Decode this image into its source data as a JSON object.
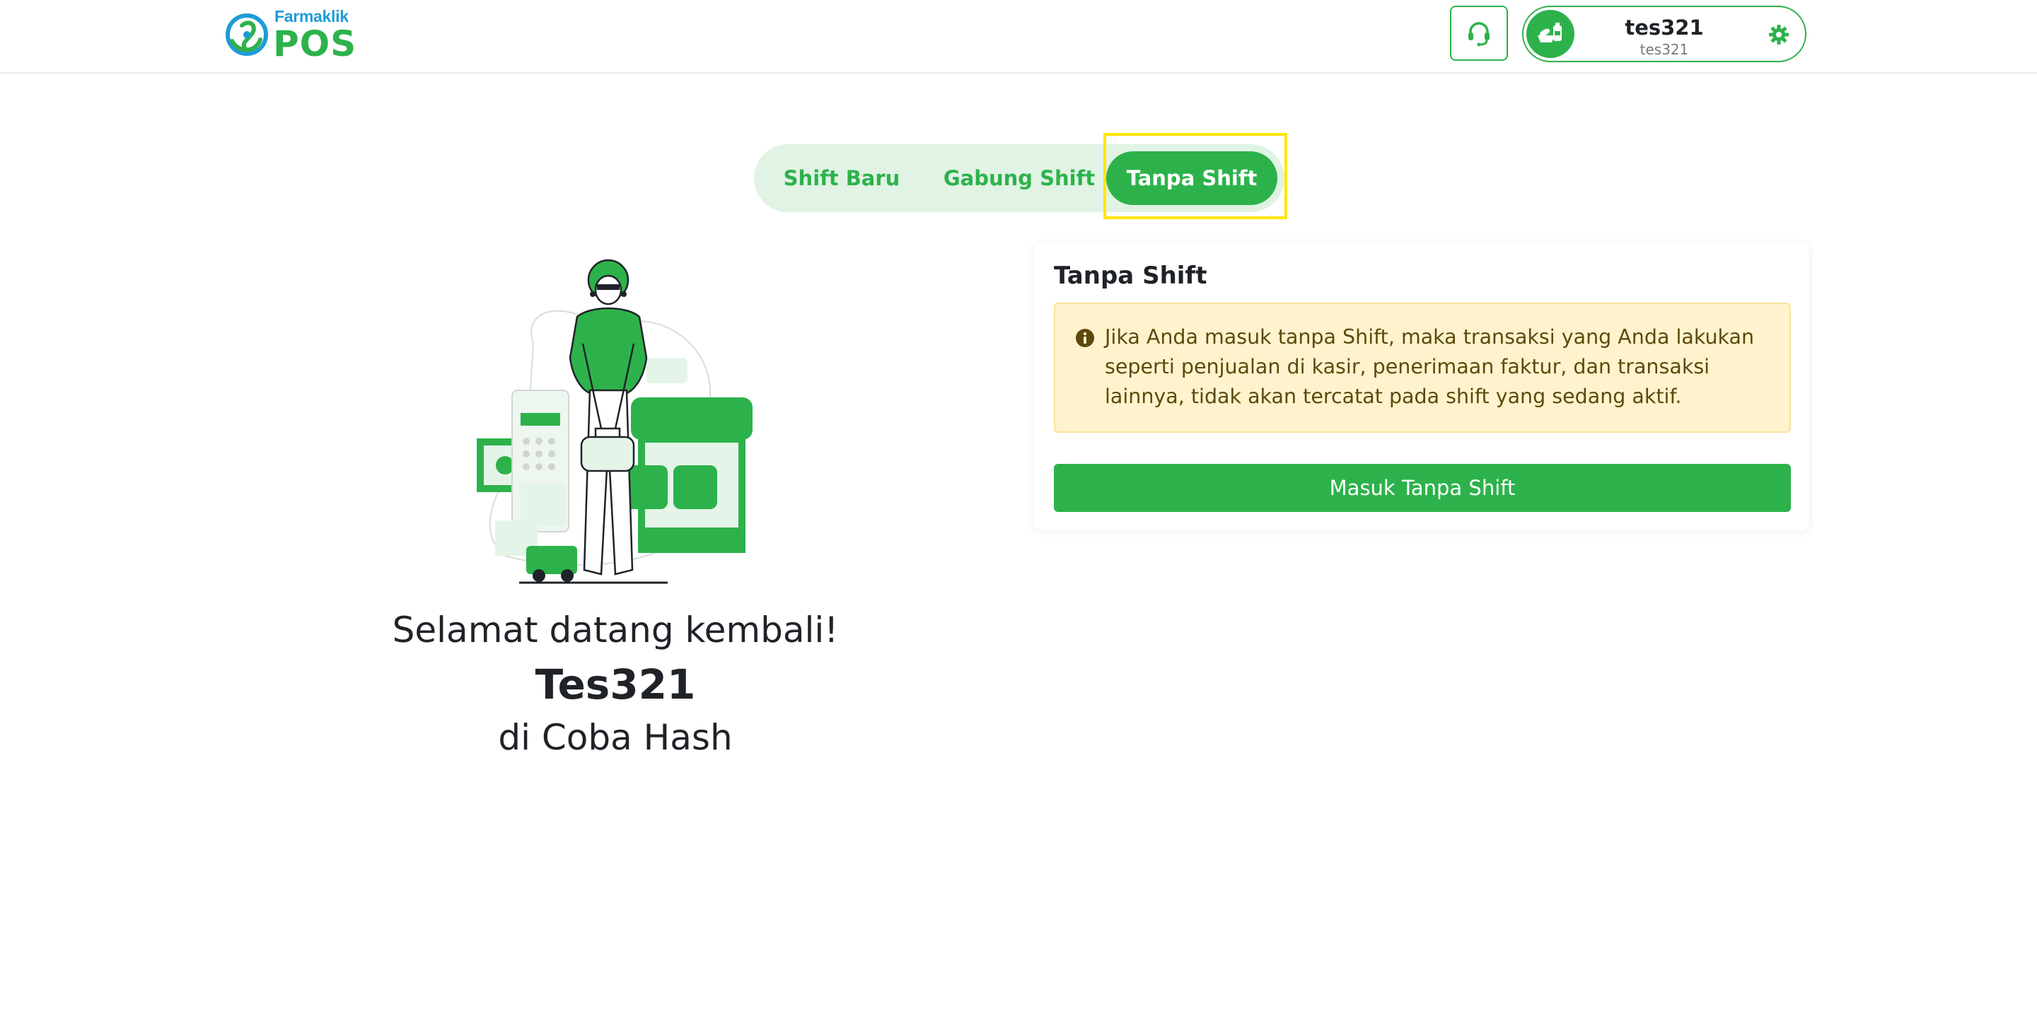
{
  "header": {
    "logo_small": "Farmaklik",
    "logo_big": "POS",
    "support_icon": "headset-icon",
    "user": {
      "name": "tes321",
      "username": "tes321",
      "avatar_icon": "pharmacy-avatar-icon",
      "settings_icon": "gear-icon"
    }
  },
  "tabs": [
    {
      "label": "Shift Baru",
      "active": false
    },
    {
      "label": "Gabung Shift",
      "active": false
    },
    {
      "label": "Tanpa Shift",
      "active": true
    }
  ],
  "welcome": {
    "greeting": "Selamat datang kembali!",
    "name": "Tes321",
    "location": "di Coba Hash"
  },
  "card": {
    "title": "Tanpa Shift",
    "alert_icon": "info-icon",
    "alert_text": "Jika Anda masuk tanpa Shift, maka transaksi yang Anda lakukan seperti penjualan di kasir, penerimaan faktur, dan transaksi lainnya, tidak akan tercatat pada shift yang sedang aktif.",
    "button_label": "Masuk Tanpa Shift"
  },
  "colors": {
    "brand_green": "#2db24b",
    "brand_blue": "#1e9bd7",
    "tab_bg": "#e0f3e4",
    "alert_bg": "#fff3cd",
    "highlight": "#ffe600"
  }
}
